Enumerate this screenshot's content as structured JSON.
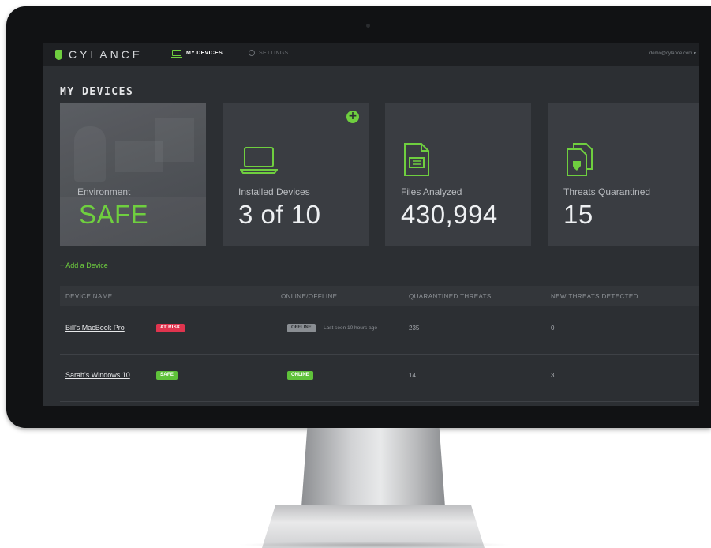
{
  "app": {
    "brand": "CYLANCE",
    "user_email": "demo@cylance.com"
  },
  "nav": {
    "tabs": [
      {
        "label": "MY DEVICES",
        "active": true,
        "icon": "laptop-icon"
      },
      {
        "label": "SETTINGS",
        "active": false,
        "icon": "gear-icon"
      }
    ]
  },
  "page": {
    "title": "MY DEVICES"
  },
  "cards": [
    {
      "label": "Environment",
      "value": "SAFE"
    },
    {
      "label": "Installed Devices",
      "value": "3 of 10",
      "action": "+"
    },
    {
      "label": "Files Analyzed",
      "value": "430,994"
    },
    {
      "label": "Threats Quarantined",
      "value": "15"
    }
  ],
  "actions": {
    "add_device": "+ Add a Device"
  },
  "table": {
    "columns": [
      "DEVICE NAME",
      "ONLINE/OFFLINE",
      "QUARANTINED THREATS",
      "NEW THREATS DETECTED"
    ],
    "rows": [
      {
        "name": "Bill's MacBook Pro",
        "badge": "AT RISK",
        "status": "OFFLINE",
        "last_seen": "Last seen 10 hours ago",
        "quarantined": "235",
        "new_threats": "0"
      },
      {
        "name": "Sarah's Windows 10",
        "badge": "SAFE",
        "status": "ONLINE",
        "last_seen": "",
        "quarantined": "14",
        "new_threats": "3"
      }
    ]
  },
  "colors": {
    "accent": "#6fcf3f",
    "danger": "#e0344e",
    "background": "#2c2f33",
    "card": "#3a3d42"
  }
}
